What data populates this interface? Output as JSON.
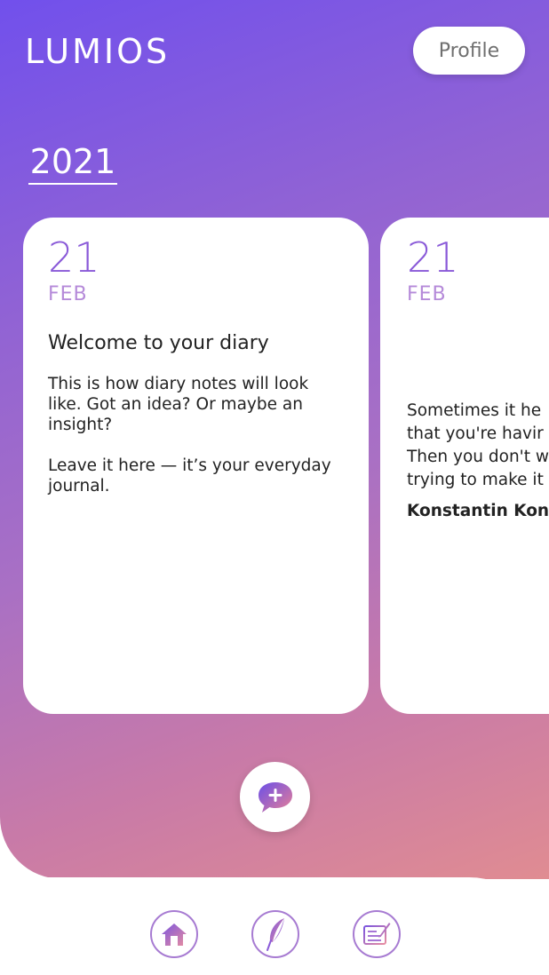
{
  "app": {
    "logo": "LUMIOS",
    "profile_label": "Profile"
  },
  "year": "2021",
  "cards": [
    {
      "day": "21",
      "month": "FEB",
      "title": "Welcome to your diary",
      "paragraphs": [
        "This is how diary notes will look like. Got an idea? Or maybe an insight?",
        "Leave it here — it’s your everyday journal."
      ]
    },
    {
      "day": "21",
      "month": "FEB",
      "lines": [
        "Sometimes it he",
        "that you're havir",
        "Then you don't w",
        "trying to make it"
      ],
      "author": "Konstantin Kons"
    }
  ],
  "icons": {
    "add": "add-note-chat-icon",
    "nav": [
      "home-icon",
      "feather-icon",
      "journal-edit-icon"
    ]
  },
  "colors": {
    "gradient_top": "#7150ec",
    "gradient_bottom": "#e08c92",
    "date_purple": "#8a5ad8",
    "month_pink": "#b58ad9"
  }
}
